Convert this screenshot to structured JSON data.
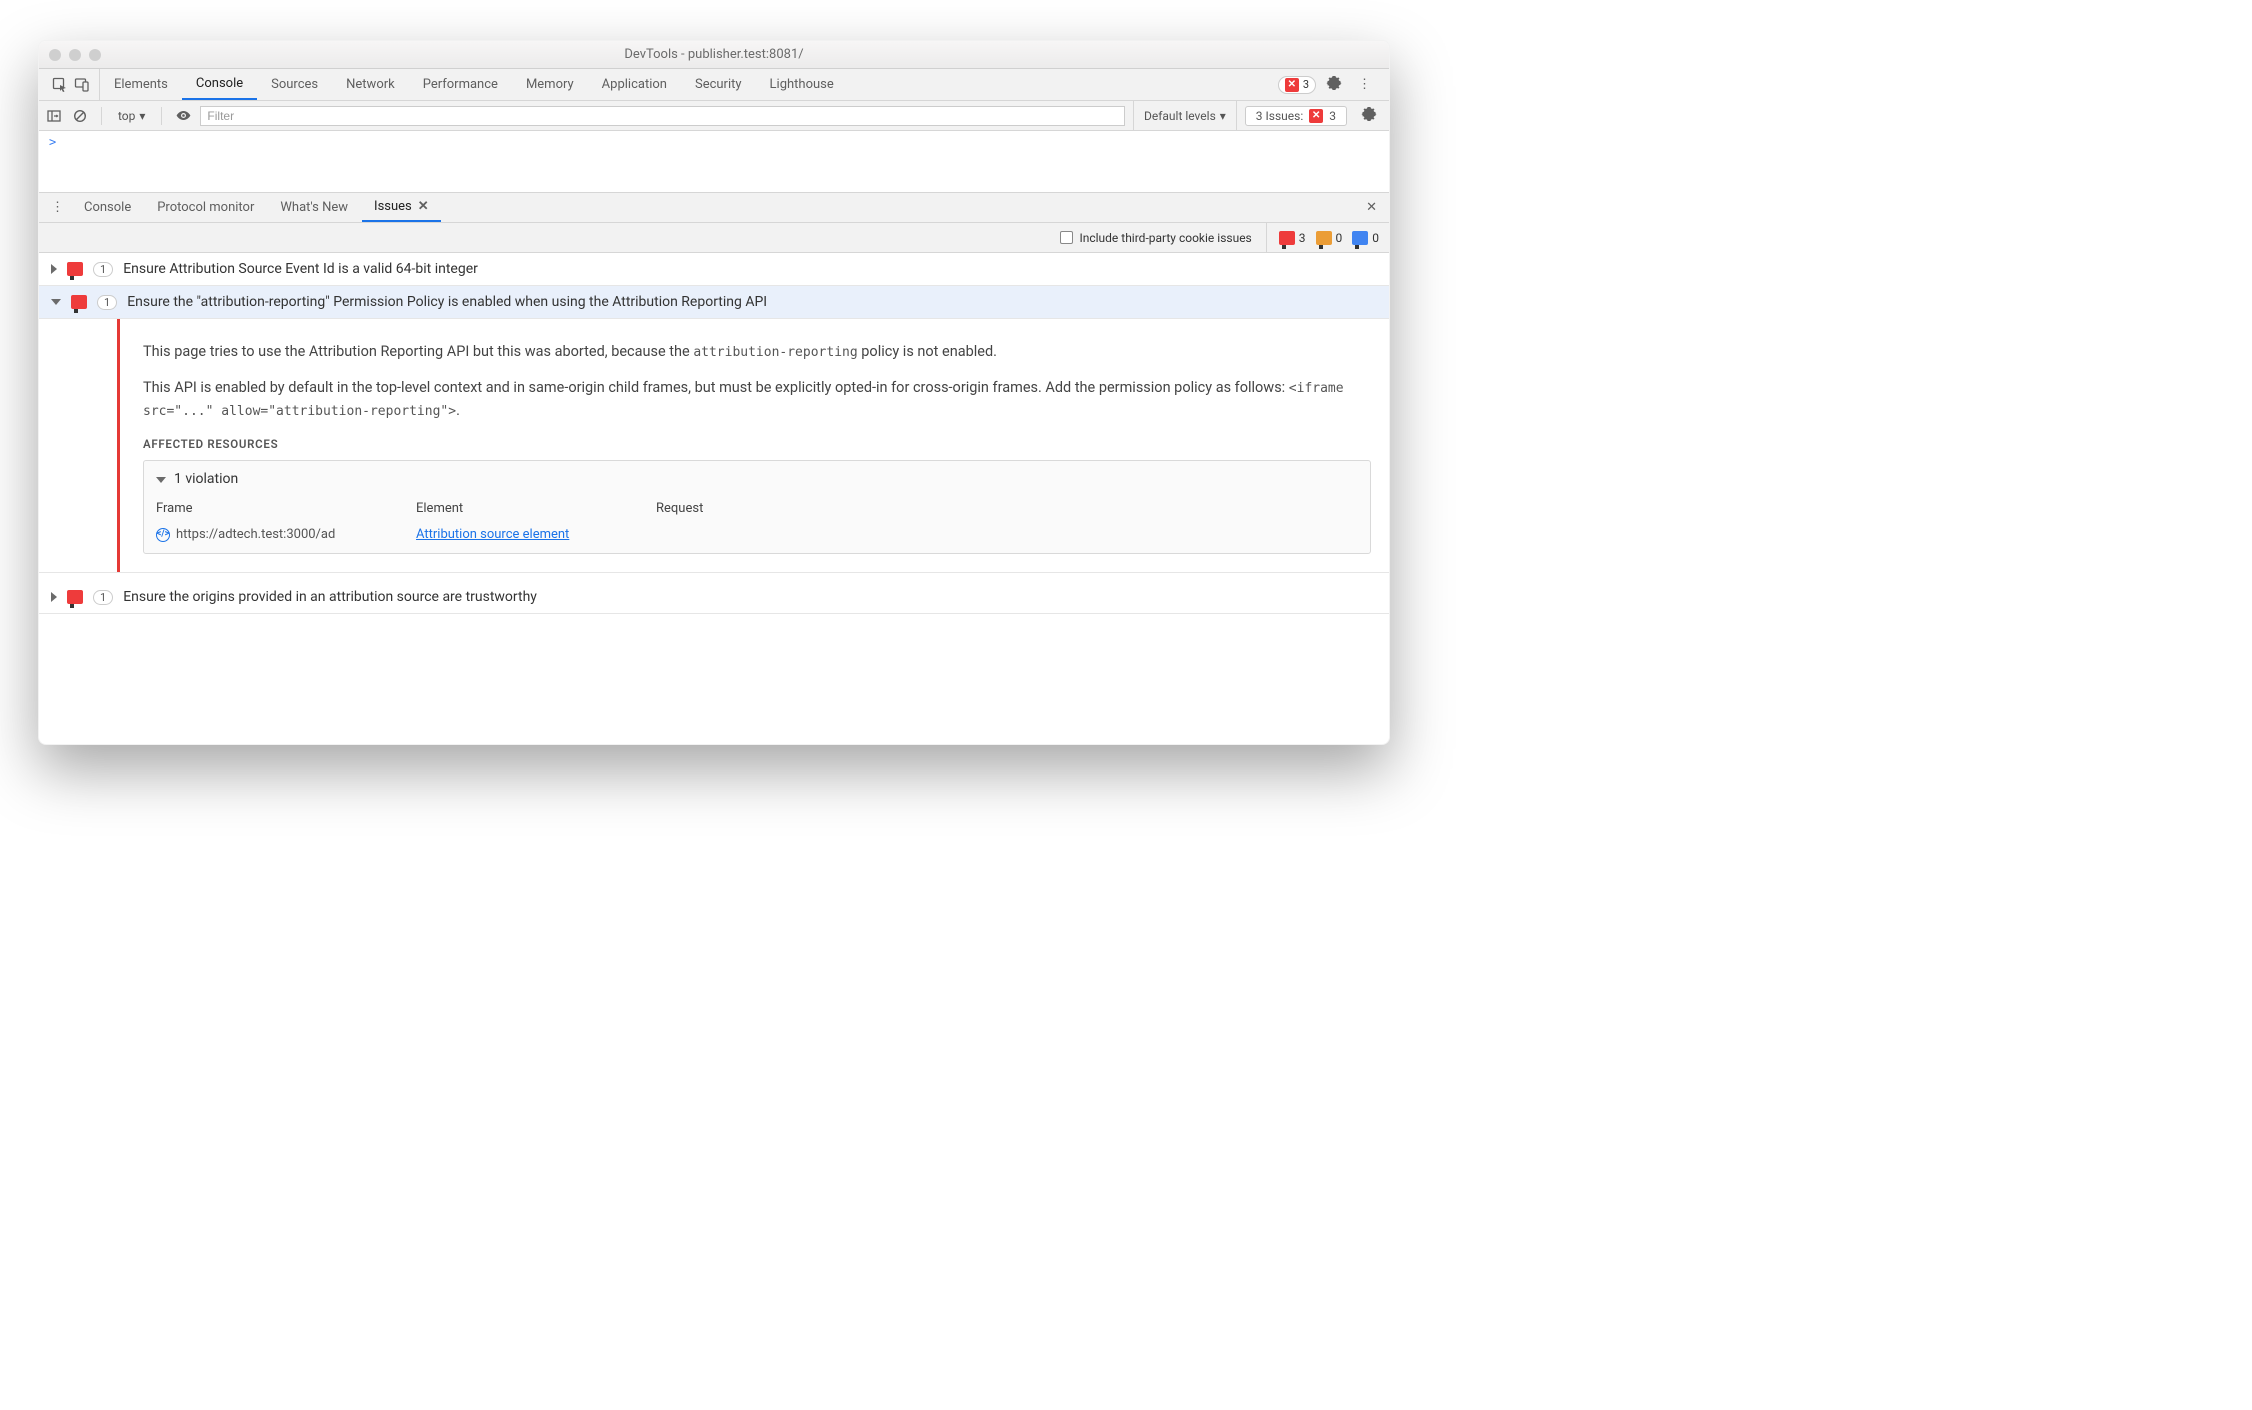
{
  "window": {
    "title": "DevTools - publisher.test:8081/"
  },
  "mainTabs": [
    "Elements",
    "Console",
    "Sources",
    "Network",
    "Performance",
    "Memory",
    "Application",
    "Security",
    "Lighthouse"
  ],
  "mainTabActive": "Console",
  "topRight": {
    "errorCount": "3"
  },
  "consoleBar": {
    "context": "top",
    "filterPlaceholder": "Filter",
    "levels": "Default levels",
    "issuesLabel": "3 Issues:",
    "issuesCount": "3"
  },
  "prompt": ">",
  "drawerTabs": [
    "Console",
    "Protocol monitor",
    "What's New",
    "Issues"
  ],
  "drawerTabActive": "Issues",
  "issuesToolbar": {
    "includeThirdParty": "Include third-party cookie issues",
    "counts": {
      "red": "3",
      "orange": "0",
      "blue": "0"
    }
  },
  "issues": [
    {
      "count": "1",
      "title": "Ensure Attribution Source Event Id is a valid 64-bit integer"
    },
    {
      "count": "1",
      "title": "Ensure the \"attribution-reporting\" Permission Policy is enabled when using the Attribution Reporting API"
    },
    {
      "count": "1",
      "title": "Ensure the origins provided in an attribution source are trustworthy"
    }
  ],
  "detail": {
    "para1a": "This page tries to use the Attribution Reporting API but this was aborted, because the ",
    "para1code": "attribution-reporting",
    "para1b": " policy is not enabled.",
    "para2a": "This API is enabled by default in the top-level context and in same-origin child frames, but must be explicitly opted-in for cross-origin frames. Add the permission policy as follows: ",
    "para2code": "<iframe src=\"...\" allow=\"attribution-reporting\">",
    "para2b": ".",
    "affectedLabel": "AFFECTED RESOURCES",
    "violationLabel": "1 violation",
    "table": {
      "headers": {
        "frame": "Frame",
        "element": "Element",
        "request": "Request"
      },
      "row": {
        "frame": "https://adtech.test:3000/ad",
        "element": "Attribution source element"
      }
    }
  }
}
